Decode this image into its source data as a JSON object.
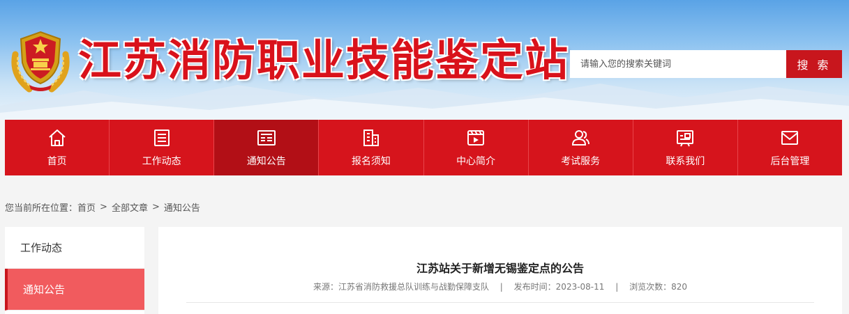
{
  "header": {
    "site_title": "江苏消防职业技能鉴定站",
    "search_placeholder": "请输入您的搜索关键词",
    "search_button": "搜 索"
  },
  "nav": {
    "items": [
      {
        "label": "首页",
        "icon": "home-icon"
      },
      {
        "label": "工作动态",
        "icon": "list-icon"
      },
      {
        "label": "通知公告",
        "icon": "news-icon"
      },
      {
        "label": "报名须知",
        "icon": "building-icon"
      },
      {
        "label": "中心简介",
        "icon": "video-icon"
      },
      {
        "label": "考试服务",
        "icon": "users-icon"
      },
      {
        "label": "联系我们",
        "icon": "contact-card-icon"
      },
      {
        "label": "后台管理",
        "icon": "mail-icon"
      }
    ],
    "active_index": 2
  },
  "breadcrumb": {
    "prefix": "您当前所在位置：",
    "items": [
      "首页",
      "全部文章",
      "通知公告"
    ],
    "separator": ">"
  },
  "sidebar": {
    "items": [
      "工作动态",
      "通知公告"
    ],
    "active_index": 1
  },
  "article": {
    "title": "江苏站关于新增无锡鉴定点的公告",
    "source_label": "来源：江苏省消防救援总队训练与战勤保障支队",
    "date_label": "发布时间：2023-08-11",
    "views_label": "浏览次数：820",
    "meta_divider": "|"
  },
  "colors": {
    "brand_red": "#d6141c",
    "active_red": "#b20f16",
    "sidebar_active": "#f15b5e"
  }
}
